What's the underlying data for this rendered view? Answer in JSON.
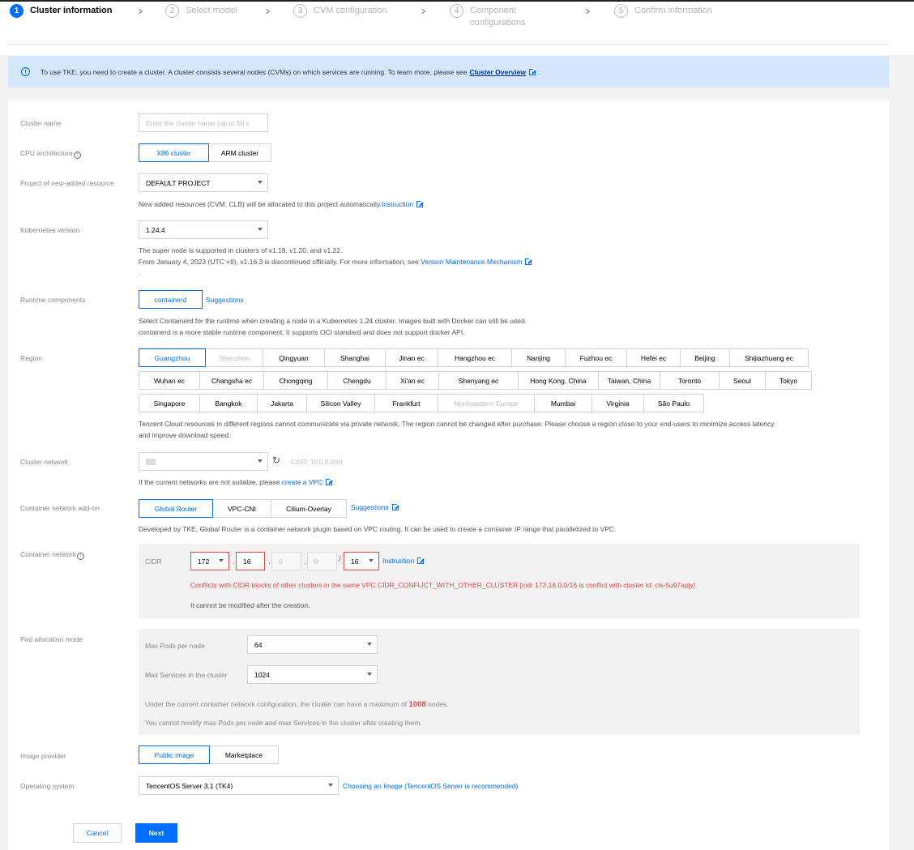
{
  "steps": [
    {
      "num": "1",
      "label": "Cluster information"
    },
    {
      "num": "2",
      "label": "Select model"
    },
    {
      "num": "3",
      "label": "CVM configuration"
    },
    {
      "num": "4",
      "label": "Component configurations"
    },
    {
      "num": "5",
      "label": "Confirm information"
    }
  ],
  "notice": {
    "text": "To use TKE, you need to create a cluster. A cluster consists several nodes (CVMs) on which services are running. To learn more, please see",
    "link": "Cluster Overview",
    "suffix": "."
  },
  "cluster_name": {
    "label": "Cluster name",
    "placeholder": "Enter the cluster name (up to 50 c"
  },
  "cpu_arch": {
    "label": "CPU architecture",
    "options": [
      "X86 cluster",
      "ARM cluster"
    ],
    "selected": "X86 cluster"
  },
  "project": {
    "label": "Project of new-added resource",
    "value": "DEFAULT PROJECT",
    "help": "New added resources (CVM, CLB) will be allocated to this project automatically.",
    "help_link": "Instruction"
  },
  "k8s": {
    "label": "Kubernetes version",
    "value": "1.24.4",
    "help1": "The super node is supported in clusters of v1.18, v1.20, and v1.22.",
    "help2": "From January 4, 2023 (UTC +8), v1.16.3 is discontinued officially. For more information, see",
    "help2_link": "Version Maintenance Mechanism",
    "help3": "."
  },
  "runtime": {
    "label": "Runtime components",
    "value": "containerd",
    "link": "Suggestions",
    "help1": "Select Containerd for the runtime when creating a node in a Kubernetes 1.24 cluster. Images built with Docker can still be used.",
    "help2": "containerd is a more stable runtime component. It supports OCI standard and does not support docker API."
  },
  "region": {
    "label": "Region",
    "selected": "Guangzhou",
    "rows": [
      [
        "Guangzhou",
        "Shenzhen",
        "Qingyuan",
        "Shanghai",
        "Jinan ec",
        "Hangzhou ec",
        "Nanjing",
        "Fuzhou ec",
        "Hefei ec",
        "Beijing",
        "Shijiazhuang ec"
      ],
      [
        "Wuhan ec",
        "Changsha ec",
        "Chongqing",
        "Chengdu",
        "Xi'an ec",
        "Shenyang ec",
        "Hong Kong, China",
        "Taiwan, China",
        "Toronto",
        "Seoul",
        "Tokyo"
      ],
      [
        "Singapore",
        "Bangkok",
        "Jakarta",
        "Silicon Valley",
        "Frankfurt",
        "Northeastern Europe",
        "Mumbai",
        "Virginia",
        "São Paulo"
      ]
    ],
    "disabled": [
      "Shenzhen",
      "Northeastern Europe"
    ],
    "help1": "Tencent Cloud resources in different regions cannot communicate via private network. The region cannot be changed after purchase. Please choose a region close to your end-users to minimize access latency",
    "help2": "and improve download speed."
  },
  "cluster_network": {
    "label": "Cluster network",
    "cidr": "CIDR: 10.0.0.0/16",
    "help": "If the current networks are not suitable, please",
    "help_link": "create a VPC",
    "help_suffix": "."
  },
  "addon": {
    "label": "Container network add-on",
    "options": [
      "Global Router",
      "VPC-CNI",
      "Cilium-Overlay"
    ],
    "selected": "Global Router",
    "link": "Suggestions",
    "help": "Developed by TKE, Global Router is a container network plugin based on VPC routing. It can be used to create a container IP range that parallelized to VPC."
  },
  "container_network": {
    "label": "Container network",
    "cidr_label": "CIDR",
    "octet1": "172",
    "octet2": "16",
    "octet3": "0",
    "octet4": "0",
    "mask": "16",
    "dot": ".",
    "slash": "/",
    "link": "Instruction",
    "error": "Conflicts with CIDR blocks of other clusters in the same VPC CIDR_CONFLICT_WITH_OTHER_CLUSTER [cidr 172.16.0.0/16 is conflict with cluster id: cls-5u97apjy]",
    "note": "It cannot be modified after the creation."
  },
  "pod_alloc": {
    "label": "Pod allocation mode",
    "max_pods_label": "Max Pods per node",
    "max_pods": "64",
    "max_svc_label": "Max Services in the cluster",
    "max_svc": "1024",
    "help1_pre": "Under the current container network configuration, the cluster can have a maximum of",
    "help1_num": "1008",
    "help1_post": "nodes.",
    "help2": "You cannot modify max Pods per node and max Services in the cluster after creating them."
  },
  "image_provider": {
    "label": "Image provider",
    "options": [
      "Public image",
      "Marketplace"
    ],
    "selected": "Public image"
  },
  "os": {
    "label": "Operating system",
    "value": "TencentOS Server 3.1 (TK4)",
    "link": "Choosing an Image (TencentOS Server is recommended)"
  },
  "footer": {
    "cancel": "Cancel",
    "next": "Next"
  },
  "colors": {
    "accent": "#006eff",
    "error": "#e54545",
    "notice_bg": "#d5e7fd"
  }
}
